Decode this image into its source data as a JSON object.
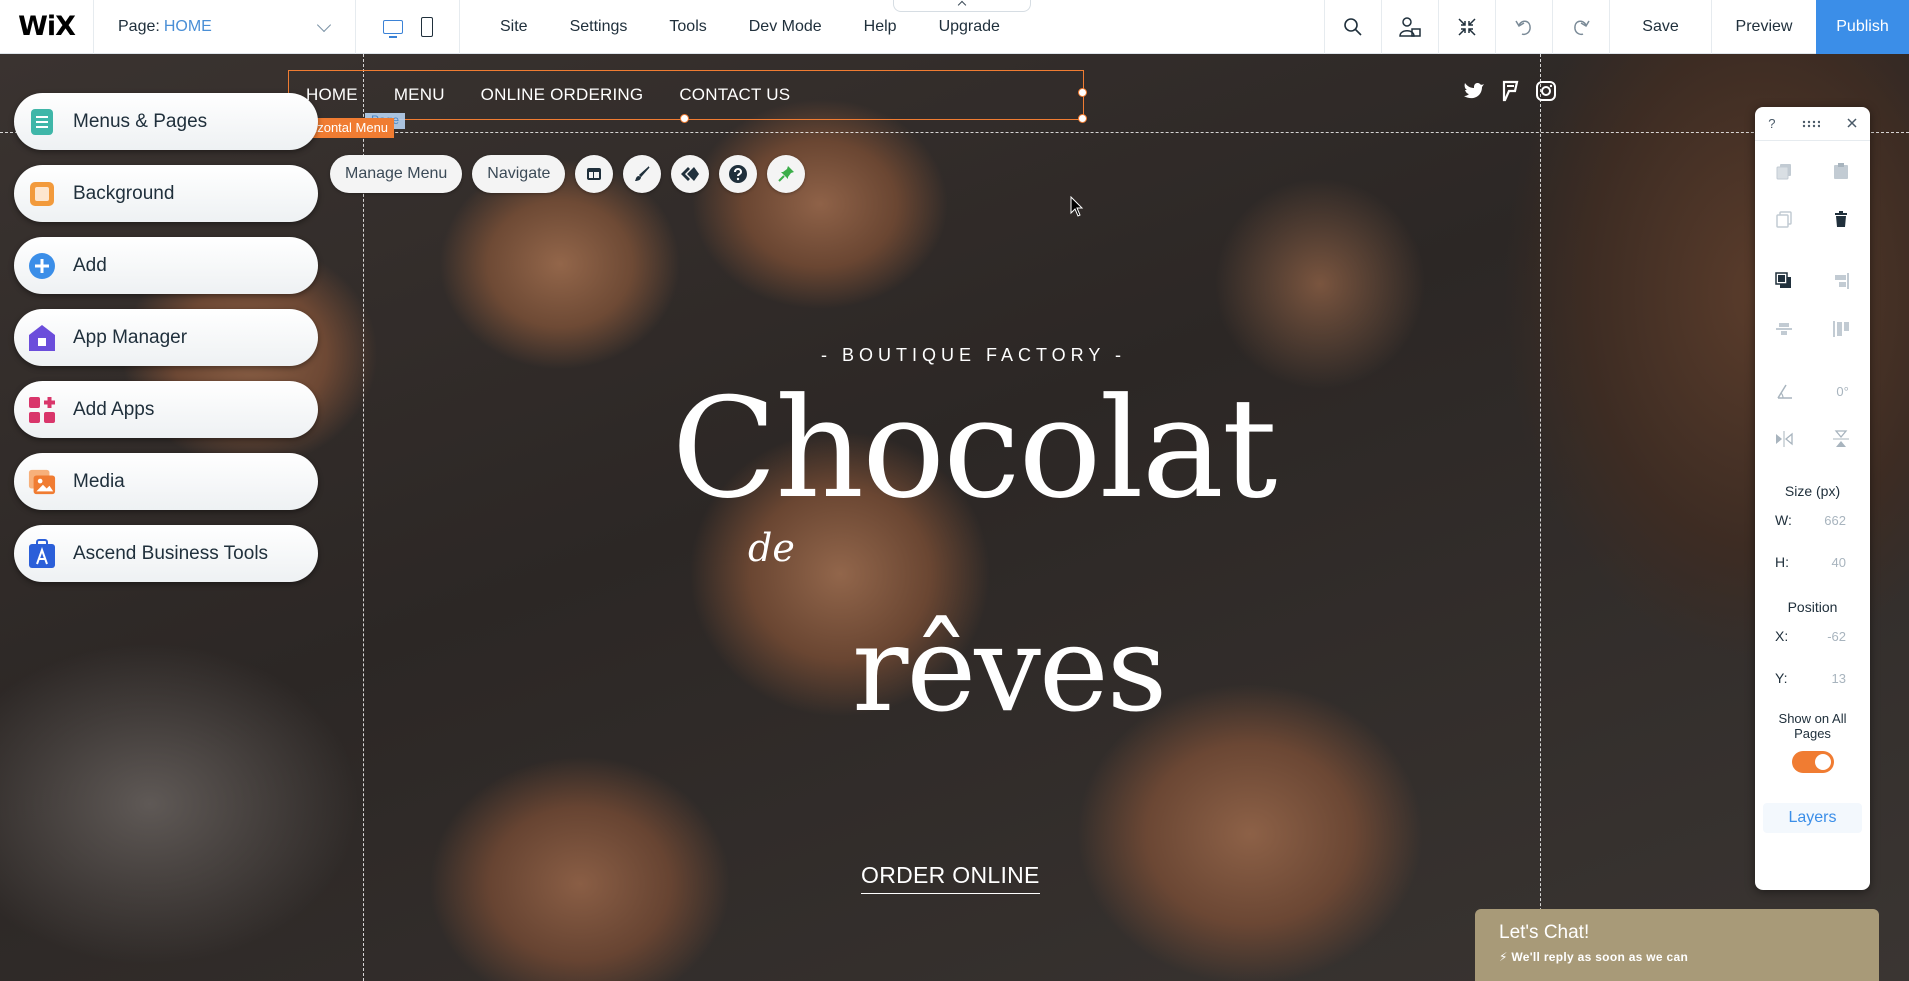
{
  "topbar": {
    "logo": "WiX",
    "page_label": "Page:",
    "page_value": "HOME",
    "menu": [
      "Site",
      "Settings",
      "Tools",
      "Dev Mode",
      "Help",
      "Upgrade"
    ],
    "save": "Save",
    "preview": "Preview",
    "publish": "Publish",
    "icons": [
      "search-icon",
      "people-icon",
      "collapse-icon",
      "undo-icon",
      "redo-icon"
    ],
    "accent": "#3b8ee8"
  },
  "site_nav": {
    "items": [
      "HOME",
      "MENU",
      "ONLINE ORDERING",
      "CONTACT US"
    ],
    "component_label": "rizontal Menu",
    "page_tag": "Page",
    "social_icons": [
      "twitter-icon",
      "foursquare-icon",
      "instagram-icon"
    ]
  },
  "component_toolbar": {
    "manage_menu": "Manage Menu",
    "navigate": "Navigate",
    "icons": [
      "layout-icon",
      "design-brush-icon",
      "animation-icon",
      "help-icon",
      "pin-icon"
    ]
  },
  "left_panel": {
    "items": [
      {
        "label": "Menus & Pages",
        "icon": "pages-icon",
        "color": "#3fb6a8"
      },
      {
        "label": "Background",
        "icon": "background-icon",
        "color": "#f29a3c"
      },
      {
        "label": "Add",
        "icon": "plus-icon",
        "color": "#3b8ee8"
      },
      {
        "label": "App Manager",
        "icon": "app-manager-icon",
        "color": "#6b4ddb"
      },
      {
        "label": "Add Apps",
        "icon": "apps-icon",
        "color": "#d9366b"
      },
      {
        "label": "Media",
        "icon": "media-icon",
        "color": "#f07c32"
      },
      {
        "label": "Ascend Business Tools",
        "icon": "ascend-icon",
        "color": "#2b5fd9"
      }
    ]
  },
  "hero": {
    "subtitle": "- BOUTIQUE FACTORY -",
    "title": "Chocolat",
    "de": "de",
    "reves": "rêves",
    "cta": "ORDER ONLINE"
  },
  "inspector": {
    "help": "?",
    "size_heading": "Size (px)",
    "w_label": "W:",
    "w_value": "662",
    "h_label": "H:",
    "h_value": "40",
    "position_heading": "Position",
    "x_label": "X:",
    "x_value": "-62",
    "y_label": "Y:",
    "y_value": "13",
    "rotation": "0°",
    "show_all_pages": "Show on All Pages",
    "show_all_pages_on": true,
    "layers": "Layers"
  },
  "chat": {
    "title": "Let's Chat!",
    "subtitle": "We'll reply as soon as we can"
  }
}
